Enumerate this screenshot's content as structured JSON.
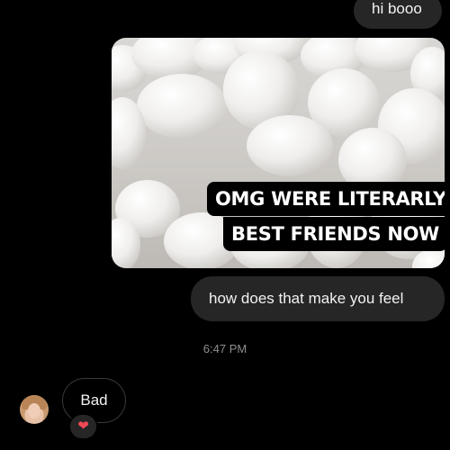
{
  "messages": {
    "top_outgoing": "hi booo",
    "image_caption_line1": "OMG WERE LITERARLY",
    "image_caption_line2": "BEST FRIENDS NOW",
    "outgoing_question": "how does that make you feel",
    "timestamp": "6:47 PM",
    "incoming_reply": "Bad",
    "reaction_icon": "heart-emoji",
    "reaction_glyph": "❤"
  },
  "colors": {
    "background": "#000000",
    "outgoing_bubble": "#262626",
    "incoming_border": "#3a3a3a",
    "timestamp": "#8e8e8e",
    "reaction_heart": "#ed4956"
  }
}
